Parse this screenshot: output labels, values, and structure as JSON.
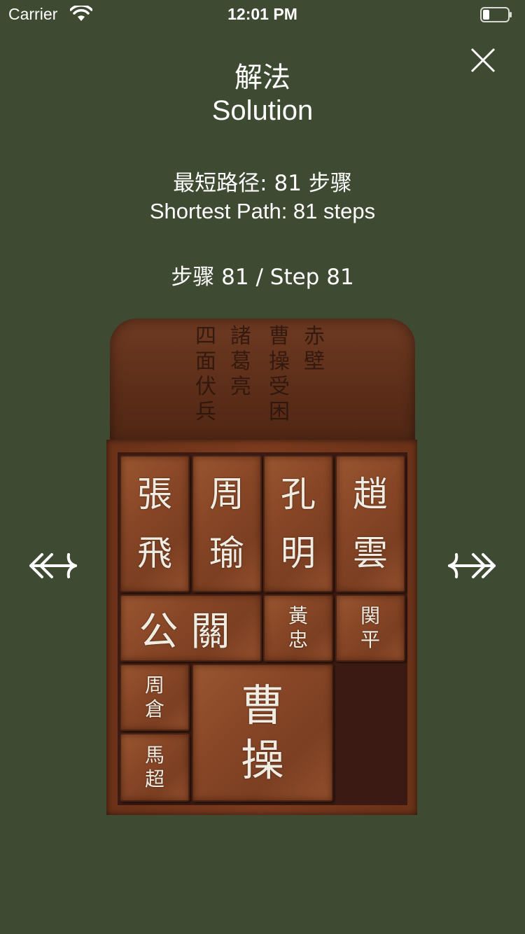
{
  "status_bar": {
    "carrier": "Carrier",
    "time": "12:01 PM"
  },
  "header": {
    "title_cn": "解法",
    "title_en": "Solution",
    "shortest_path_cn": "最短路径: 81 步骤",
    "shortest_path_en": "Shortest Path: 81 steps",
    "step_label": "步骤 81 / Step 81",
    "close_icon": "close-icon"
  },
  "board": {
    "inscription_columns": [
      "四面伏兵",
      "諸葛亮",
      "曹操受困",
      "赤壁"
    ],
    "tiles": {
      "zhang_fei": "張\n飛",
      "zhou_yu": "周\n瑜",
      "kong_ming": "孔\n明",
      "zhao_yun": "趙\n雲",
      "guan_gong": "公關",
      "huang_zhong": "黃\n忠",
      "guan_ping": "関\n平",
      "zhou_cang": "周\n倉",
      "ma_chao": "馬\n超",
      "cao_cao": "曹\n操"
    }
  },
  "navigation": {
    "prev_icon": "double-arrow-left-icon",
    "next_icon": "double-arrow-right-icon"
  },
  "colors": {
    "background": "#3e4a31",
    "tile": "#874626",
    "frame": "#6b3219",
    "text": "#ffffff"
  }
}
